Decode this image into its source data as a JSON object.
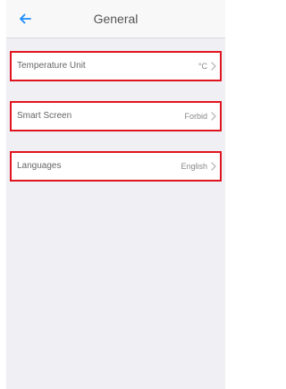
{
  "navbar": {
    "title": "General",
    "back_icon": "back-arrow-icon",
    "accent_color": "#1a8cff"
  },
  "settings": [
    {
      "label": "Temperature Unit",
      "value": "°C"
    },
    {
      "label": "Smart Screen",
      "value": "Forbid"
    },
    {
      "label": "Languages",
      "value": "English"
    }
  ],
  "highlight_color": "#e0141e"
}
